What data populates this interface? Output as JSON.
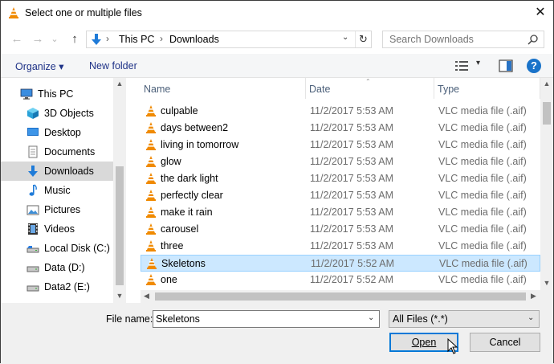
{
  "window": {
    "title": "Select one or multiple files",
    "close_glyph": "✕"
  },
  "nav": {
    "back_glyph": "←",
    "forward_glyph": "→",
    "recent_glyph": "⌄",
    "up_glyph": "↑",
    "address": {
      "crumbs": [
        "This PC",
        "Downloads"
      ],
      "separator": "›",
      "dropdown_glyph": "⌄",
      "refresh_glyph": "↻"
    },
    "search_placeholder": "Search Downloads"
  },
  "toolbar": {
    "organize_label": "Organize ▾",
    "new_folder_label": "New folder",
    "view_dropdown_glyph": "▾",
    "help_glyph": "?"
  },
  "sidebar": {
    "items": [
      {
        "label": "This PC",
        "icon": "computer-icon",
        "root": true
      },
      {
        "label": "3D Objects",
        "icon": "cube-icon"
      },
      {
        "label": "Desktop",
        "icon": "desktop-icon"
      },
      {
        "label": "Documents",
        "icon": "documents-icon"
      },
      {
        "label": "Downloads",
        "icon": "download-arrow-icon",
        "selected": true
      },
      {
        "label": "Music",
        "icon": "music-note-icon"
      },
      {
        "label": "Pictures",
        "icon": "pictures-icon"
      },
      {
        "label": "Videos",
        "icon": "film-icon"
      },
      {
        "label": "Local Disk (C:)",
        "icon": "drive-icon"
      },
      {
        "label": "Data (D:)",
        "icon": "drive-icon"
      },
      {
        "label": "Data2 (E:)",
        "icon": "drive-icon"
      }
    ],
    "scroll_up_glyph": "▲",
    "scroll_down_glyph": "▼"
  },
  "filelist": {
    "columns": [
      "Name",
      "Date",
      "Type"
    ],
    "sort_glyph": "⌃",
    "rows": [
      {
        "name": "culpable",
        "date": "11/2/2017 5:53 AM",
        "type": "VLC media file (.aif)"
      },
      {
        "name": "days between2",
        "date": "11/2/2017 5:53 AM",
        "type": "VLC media file (.aif)"
      },
      {
        "name": "living in tomorrow",
        "date": "11/2/2017 5:53 AM",
        "type": "VLC media file (.aif)"
      },
      {
        "name": "glow",
        "date": "11/2/2017 5:53 AM",
        "type": "VLC media file (.aif)"
      },
      {
        "name": "the dark light",
        "date": "11/2/2017 5:53 AM",
        "type": "VLC media file (.aif)"
      },
      {
        "name": "perfectly clear",
        "date": "11/2/2017 5:53 AM",
        "type": "VLC media file (.aif)"
      },
      {
        "name": "make it rain",
        "date": "11/2/2017 5:53 AM",
        "type": "VLC media file (.aif)"
      },
      {
        "name": "carousel",
        "date": "11/2/2017 5:53 AM",
        "type": "VLC media file (.aif)"
      },
      {
        "name": "three",
        "date": "11/2/2017 5:53 AM",
        "type": "VLC media file (.aif)"
      },
      {
        "name": "Skeletons",
        "date": "11/2/2017 5:52 AM",
        "type": "VLC media file (.aif)",
        "selected": true
      },
      {
        "name": "one",
        "date": "11/2/2017 5:52 AM",
        "type": "VLC media file (.aif)"
      }
    ],
    "scroll_up_glyph": "▲",
    "scroll_down_glyph": "▼",
    "scroll_left_glyph": "◀",
    "scroll_right_glyph": "▶"
  },
  "bottom": {
    "filename_label": "File name:",
    "filename_value": "Skeletons",
    "filename_dropdown_glyph": "⌄",
    "filter_value": "All Files (*.*)",
    "filter_dropdown_glyph": "⌄",
    "open_label": "Open",
    "cancel_label": "Cancel"
  },
  "colors": {
    "accent": "#0078d7",
    "selection": "#cce8ff",
    "link": "#1e3287",
    "vlc_orange": "#f08a00"
  }
}
